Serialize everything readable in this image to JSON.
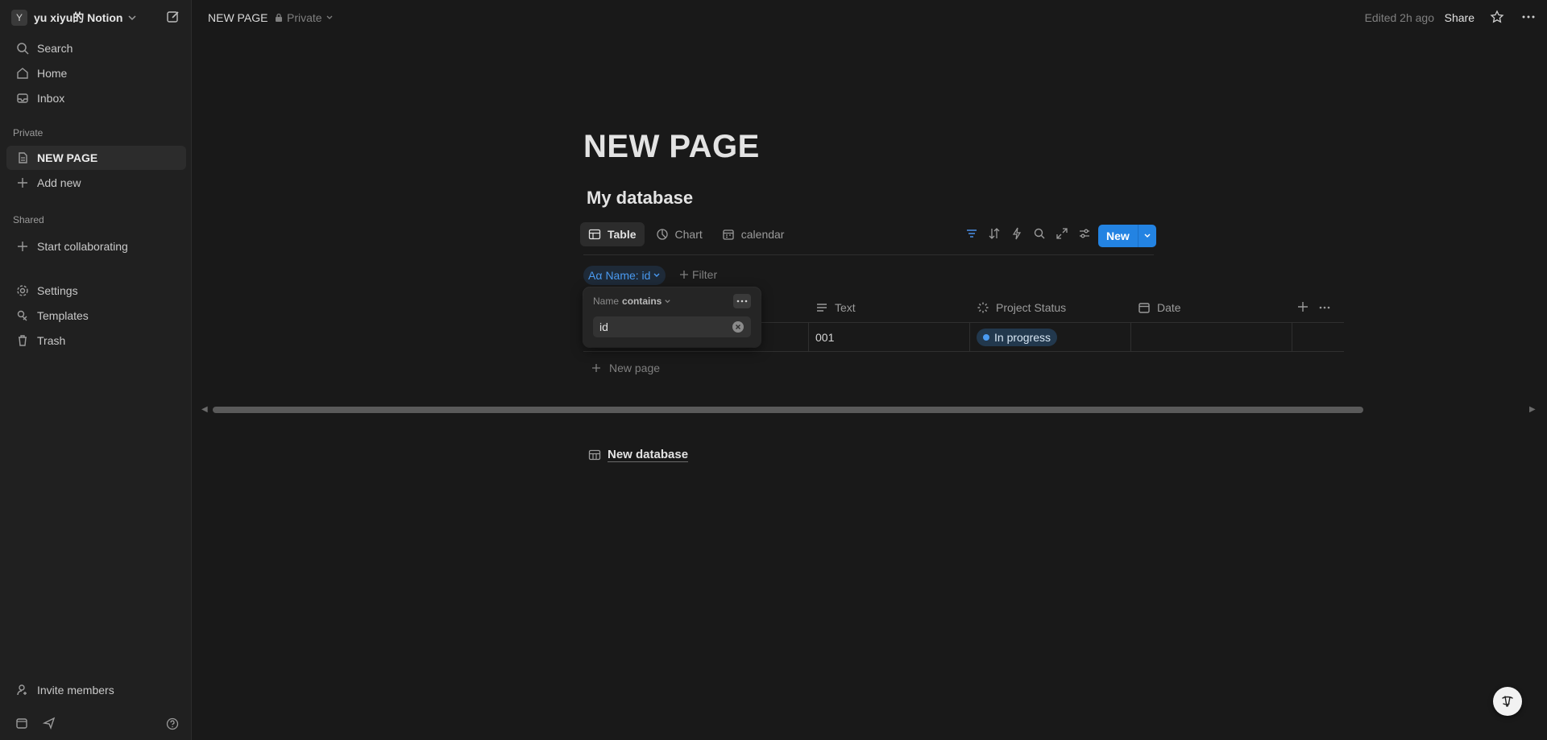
{
  "workspace": {
    "avatar_letter": "Y",
    "name": "yu xiyu的 Notion"
  },
  "sidebar": {
    "top_items": [
      {
        "label": "Search",
        "icon": "search-icon"
      },
      {
        "label": "Home",
        "icon": "home-icon"
      },
      {
        "label": "Inbox",
        "icon": "inbox-icon"
      }
    ],
    "private_label": "Private",
    "private_items": [
      {
        "label": "NEW PAGE",
        "icon": "page-icon"
      },
      {
        "label": "Add new",
        "icon": "plus-icon"
      }
    ],
    "shared_label": "Shared",
    "shared_items": [
      {
        "label": "Start collaborating",
        "icon": "plus-icon"
      }
    ],
    "bottom_items": [
      {
        "label": "Settings",
        "icon": "gear-icon"
      },
      {
        "label": "Templates",
        "icon": "templates-icon"
      },
      {
        "label": "Trash",
        "icon": "trash-icon"
      }
    ],
    "invite_label": "Invite members"
  },
  "topbar": {
    "breadcrumb": "NEW PAGE",
    "privacy": "Private",
    "edited": "Edited 2h ago",
    "share": "Share"
  },
  "page": {
    "title": "NEW PAGE",
    "database_title": "My database",
    "views": [
      "Table",
      "Chart",
      "calendar"
    ],
    "new_button": "New",
    "filter_chip": {
      "prefix": "Aα",
      "label": "Name: id"
    },
    "add_filter": "Filter",
    "columns": [
      "Text",
      "Project Status",
      "Date"
    ],
    "rows": [
      {
        "text": "001",
        "status": "In progress",
        "date": ""
      }
    ],
    "new_page": "New page",
    "new_database": "New database"
  },
  "filter_popover": {
    "property": "Name",
    "operator": "contains",
    "value": "id"
  },
  "colors": {
    "accent": "#2383e2",
    "status_pill_bg": "#22384d",
    "status_dot": "#4a9af0"
  }
}
